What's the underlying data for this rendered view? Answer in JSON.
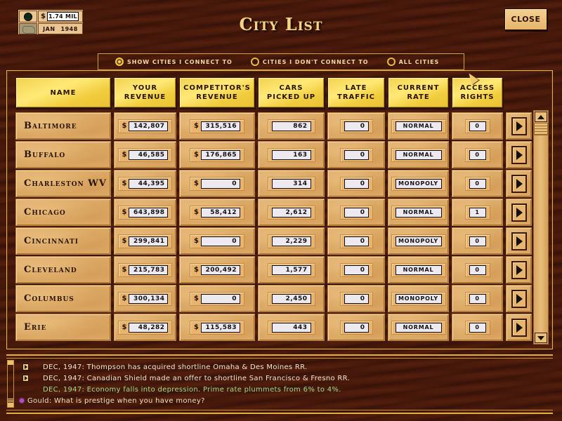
{
  "status": {
    "money_symbol": "$",
    "money_value": "1.74 MIL",
    "month": "JAN",
    "year": "1948",
    "globe_icon": "globe-icon",
    "map_icon": "map-icon"
  },
  "title": "City List",
  "close_label": "CLOSE",
  "filters": [
    {
      "label": "SHOW CITIES I CONNECT TO",
      "selected": true
    },
    {
      "label": "CITIES I DON'T CONNECT TO",
      "selected": false
    },
    {
      "label": "ALL CITIES",
      "selected": false
    }
  ],
  "columns": [
    {
      "key": "name",
      "label": "NAME"
    },
    {
      "key": "your_revenue",
      "label": "YOUR\nREVENUE"
    },
    {
      "key": "competitor_revenue",
      "label": "COMPETITOR'S\nREVENUE"
    },
    {
      "key": "cars",
      "label": "CARS\nPICKED UP"
    },
    {
      "key": "late",
      "label": "LATE\nTRAFFIC"
    },
    {
      "key": "rate",
      "label": "CURRENT\nRATE"
    },
    {
      "key": "access",
      "label": "ACCESS\nRIGHTS"
    }
  ],
  "currency_symbol": "$",
  "rows": [
    {
      "name": "Baltimore",
      "your_revenue": "142,807",
      "competitor_revenue": "315,516",
      "cars": "862",
      "late": "0",
      "rate": "NORMAL",
      "access": "0"
    },
    {
      "name": "Buffalo",
      "your_revenue": "46,585",
      "competitor_revenue": "176,865",
      "cars": "163",
      "late": "0",
      "rate": "NORMAL",
      "access": "0"
    },
    {
      "name": "Charleston WV",
      "your_revenue": "44,395",
      "competitor_revenue": "0",
      "cars": "314",
      "late": "0",
      "rate": "MONOPOLY",
      "access": "0"
    },
    {
      "name": "Chicago",
      "your_revenue": "643,898",
      "competitor_revenue": "58,412",
      "cars": "2,612",
      "late": "0",
      "rate": "NORMAL",
      "access": "1"
    },
    {
      "name": "Cincinnati",
      "your_revenue": "299,841",
      "competitor_revenue": "0",
      "cars": "2,229",
      "late": "0",
      "rate": "MONOPOLY",
      "access": "0"
    },
    {
      "name": "Cleveland",
      "your_revenue": "215,783",
      "competitor_revenue": "200,492",
      "cars": "1,577",
      "late": "0",
      "rate": "NORMAL",
      "access": "0"
    },
    {
      "name": "Columbus",
      "your_revenue": "300,134",
      "competitor_revenue": "0",
      "cars": "2,450",
      "late": "0",
      "rate": "MONOPOLY",
      "access": "0"
    },
    {
      "name": "Erie",
      "your_revenue": "48,282",
      "competitor_revenue": "115,583",
      "cars": "443",
      "late": "0",
      "rate": "NORMAL",
      "access": "0"
    }
  ],
  "messages": [
    {
      "icon": "arrow",
      "text": "DEC, 1947: Thompson has acquired shortline Omaha & Des Moines RR.",
      "style": "normal"
    },
    {
      "icon": "arrow",
      "text": "DEC, 1947: Canadian Shield made an offer to shortline San Francisco & Fresno RR.",
      "style": "normal"
    },
    {
      "icon": "none",
      "text": "DEC, 1947: Economy falls into depression. Prime rate plummets from 6% to 4%.",
      "style": "green"
    },
    {
      "icon": "lips",
      "text": "Gould: What is prestige when you have money?",
      "style": "quote"
    }
  ],
  "colors": {
    "header_gold": "#f1d24f",
    "cell_wood": "#dfae6b",
    "wood_dark": "#4a1a0c",
    "gold_trim": "#e0b04a",
    "message_green": "#9fdc8c"
  }
}
